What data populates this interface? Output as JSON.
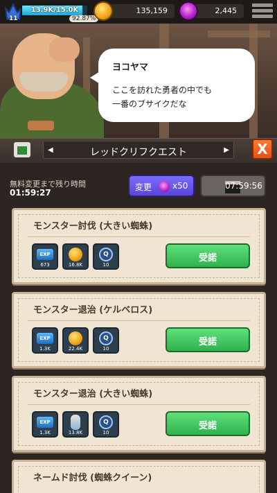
{
  "hud": {
    "level": "11",
    "xp_text": "13.9K/15.0K",
    "xp_percent_text": "92.87%",
    "xp_fraction": 0.9287,
    "gold": "135,159",
    "gems": "2,445"
  },
  "dialogue": {
    "speaker": "ヨコヤマ",
    "line1": "ここを訪れた勇者の中でも",
    "line2": "一番のブサイクだな"
  },
  "quest_header": {
    "title": "レッドクリフクエスト",
    "close": "X"
  },
  "refresh": {
    "free_change_label": "無料変更まで残り時間",
    "free_change_time": "01:59:27",
    "change_label": "変更",
    "change_cost": "x50",
    "ad_timer": "07:59:56"
  },
  "quests": [
    {
      "title": "モンスター討伐 (大きい蜘蛛)",
      "rewards": [
        {
          "type": "exp",
          "label": "EXP",
          "amount": "673"
        },
        {
          "type": "gold",
          "amount": "16.8K"
        },
        {
          "type": "quest-medal",
          "label": "Q",
          "amount": "10"
        }
      ],
      "accept_label": "受諾"
    },
    {
      "title": "モンスター退治 (ケルベロス)",
      "rewards": [
        {
          "type": "exp",
          "label": "EXP",
          "amount": "1.3K"
        },
        {
          "type": "gold",
          "amount": "22.4K"
        },
        {
          "type": "quest-medal",
          "label": "Q",
          "amount": "10"
        }
      ],
      "accept_label": "受諾"
    },
    {
      "title": "モンスター退治 (大きい蜘蛛)",
      "rewards": [
        {
          "type": "exp",
          "label": "EXP",
          "amount": "1.3K"
        },
        {
          "type": "potion",
          "amount": "13.8K"
        },
        {
          "type": "quest-medal",
          "label": "Q",
          "amount": "10"
        }
      ],
      "accept_label": "受諾"
    },
    {
      "title": "ネームド討伐 (蜘蛛クイーン)"
    }
  ]
}
